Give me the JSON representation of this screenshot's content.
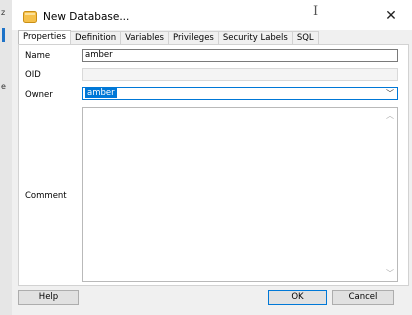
{
  "window": {
    "title": "New Database...",
    "close_glyph": "✕",
    "cursor_glyph": "I"
  },
  "background": {
    "fragments": [
      "z",
      "e"
    ]
  },
  "tabs": [
    {
      "label": "Properties",
      "active": true
    },
    {
      "label": "Definition"
    },
    {
      "label": "Variables"
    },
    {
      "label": "Privileges"
    },
    {
      "label": "Security Labels"
    },
    {
      "label": "SQL"
    }
  ],
  "form": {
    "name": {
      "label": "Name",
      "value": "amber"
    },
    "oid": {
      "label": "OID",
      "value": ""
    },
    "owner": {
      "label": "Owner",
      "value": "amber"
    },
    "comment": {
      "label": "Comment",
      "value": ""
    }
  },
  "buttons": {
    "help": "Help",
    "ok": "OK",
    "cancel": "Cancel"
  },
  "icons": {
    "database": "database-icon",
    "close": "close-icon",
    "chevron": "chevron-down-icon"
  },
  "colors": {
    "accent": "#0078d7",
    "icon_fill": "#f5c04a"
  }
}
